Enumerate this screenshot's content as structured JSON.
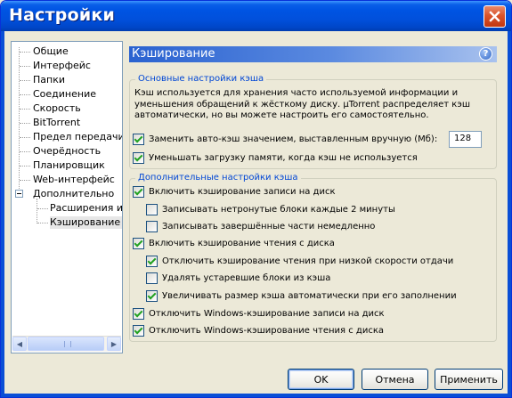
{
  "window": {
    "title": "Настройки"
  },
  "tree": {
    "items": [
      {
        "label": "Общие"
      },
      {
        "label": "Интерфейс"
      },
      {
        "label": "Папки"
      },
      {
        "label": "Соединение"
      },
      {
        "label": "Скорость"
      },
      {
        "label": "BitTorrent"
      },
      {
        "label": "Предел передачи"
      },
      {
        "label": "Очерёдность"
      },
      {
        "label": "Планировщик"
      },
      {
        "label": "Web-интерфейс"
      },
      {
        "label": "Дополнительно"
      },
      {
        "label": "Расширения интерфейса"
      },
      {
        "label": "Кэширование"
      }
    ]
  },
  "panel": {
    "title": "Кэширование",
    "basic_group": {
      "legend": "Основные настройки кэша",
      "description": "Кэш используется для хранения часто используемой информации и уменьшения обращений к жёсткому диску. µTorrent распределяет кэш автоматически, но вы можете настроить его самостоятельно.",
      "override_label": "Заменить авто-кэш значением, выставленным вручную (Мб):",
      "override_checked": true,
      "override_value": "128",
      "reduce_label": "Уменьшать загрузку памяти, когда кэш не используется",
      "reduce_checked": true
    },
    "advanced_group": {
      "legend": "Дополнительные настройки кэша",
      "options": [
        {
          "label": "Включить кэширование записи на диск",
          "checked": true
        },
        {
          "label": "Записывать нетронутые блоки каждые 2 минуты",
          "checked": false
        },
        {
          "label": "Записывать завершённые части немедленно",
          "checked": false
        },
        {
          "label": "Включить кэширование чтения с диска",
          "checked": true
        },
        {
          "label": "Отключить кэширование чтения при низкой скорости отдачи",
          "checked": true
        },
        {
          "label": "Удалять устаревшие блоки из кэша",
          "checked": false
        },
        {
          "label": "Увеличивать размер кэша автоматически при его заполнении",
          "checked": true
        },
        {
          "label": "Отключить Windows-кэширование записи на диск",
          "checked": true
        },
        {
          "label": "Отключить Windows-кэширование чтения с диска",
          "checked": true
        }
      ]
    }
  },
  "buttons": {
    "ok": "OK",
    "cancel": "Отмена",
    "apply": "Применить"
  },
  "colors": {
    "titlebar": "#0054e3",
    "legend_text": "#0046d5",
    "header_bar": "#2a62d0",
    "close_button": "#d9542c"
  },
  "icons": {
    "close": "close-icon",
    "help": "help-icon",
    "collapse": "collapse-icon"
  }
}
